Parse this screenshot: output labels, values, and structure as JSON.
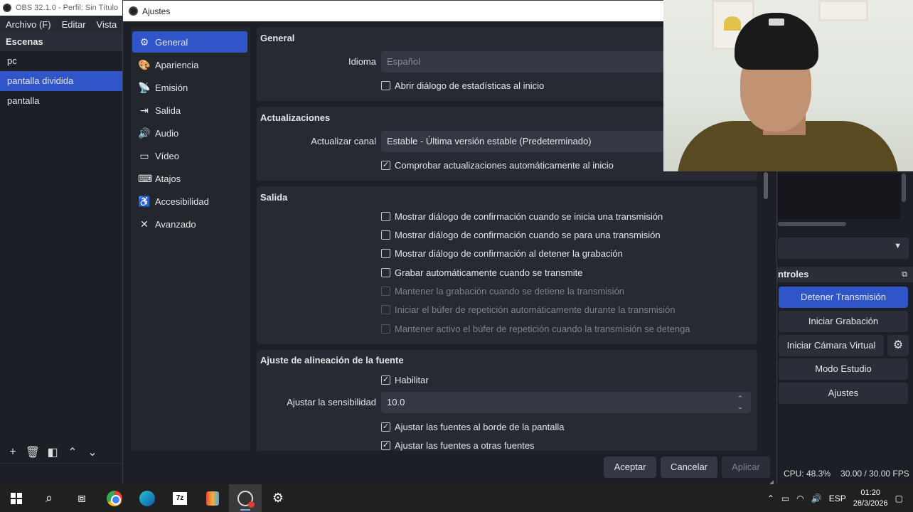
{
  "obs": {
    "title": "OBS 32.1.0 - Perfil: Sin Título",
    "menu": [
      "Archivo (F)",
      "Editar",
      "Vista"
    ],
    "scenes_header": "Escenas",
    "scenes": [
      "pc",
      "pantalla dividida",
      "pantalla"
    ],
    "controls_header": "ntroles",
    "controls": {
      "stop_stream": "Detener Transmisión",
      "start_record": "Iniciar Grabación",
      "virtual_cam": "Iniciar Cámara Virtual",
      "studio_mode": "Modo Estudio",
      "settings": "Ajustes"
    },
    "status": {
      "cpu": "CPU: 48.3%",
      "fps": "30.00 / 30.00 FPS"
    }
  },
  "dialog": {
    "title": "Ajustes",
    "nav": [
      {
        "label": "General",
        "icon": "gear-icon",
        "glyph": "⚙"
      },
      {
        "label": "Apariencia",
        "icon": "palette-icon",
        "glyph": "🎨"
      },
      {
        "label": "Emisión",
        "icon": "broadcast-icon",
        "glyph": "📡"
      },
      {
        "label": "Salida",
        "icon": "output-icon",
        "glyph": "⇥"
      },
      {
        "label": "Audio",
        "icon": "speaker-icon",
        "glyph": "🔊"
      },
      {
        "label": "Vídeo",
        "icon": "monitor-icon",
        "glyph": "▭"
      },
      {
        "label": "Atajos",
        "icon": "keyboard-icon",
        "glyph": "⌨"
      },
      {
        "label": "Accesibilidad",
        "icon": "accessibility-icon",
        "glyph": "♿"
      },
      {
        "label": "Avanzado",
        "icon": "tools-icon",
        "glyph": "✕"
      }
    ],
    "general": {
      "title": "General",
      "language_label": "Idioma",
      "language_value": "Español",
      "stats_dialog": "Abrir diálogo de estadísticas al inicio"
    },
    "updates": {
      "title": "Actualizaciones",
      "channel_label": "Actualizar canal",
      "channel_value": "Estable - Última versión estable (Predeterminado)",
      "auto_check": "Comprobar actualizaciones automáticamente al inicio"
    },
    "output": {
      "title": "Salida",
      "options": [
        {
          "label": "Mostrar diálogo de confirmación cuando se inicia una transmisión",
          "checked": false,
          "enabled": true
        },
        {
          "label": "Mostrar diálogo de confirmación cuando se para una transmisión",
          "checked": false,
          "enabled": true
        },
        {
          "label": "Mostrar diálogo de confirmación al detener la grabación",
          "checked": false,
          "enabled": true
        },
        {
          "label": "Grabar automáticamente cuando se transmite",
          "checked": false,
          "enabled": true
        },
        {
          "label": "Mantener la grabación cuando se detiene la transmisión",
          "checked": false,
          "enabled": false
        },
        {
          "label": "Iniciar el búfer de repetición automáticamente durante la transmisión",
          "checked": false,
          "enabled": false
        },
        {
          "label": "Mantener activo el búfer de repetición cuando la transmisión se detenga",
          "checked": false,
          "enabled": false
        }
      ]
    },
    "snapping": {
      "title": "Ajuste de alineación de la fuente",
      "enable": "Habilitar",
      "sensitivity_label": "Ajustar la sensibilidad",
      "sensitivity_value": "10.0",
      "screen_edge": "Ajustar las fuentes al borde de la pantalla",
      "other_sources": "Ajustar las fuentes a otras fuentes"
    },
    "buttons": {
      "accept": "Aceptar",
      "cancel": "Cancelar",
      "apply": "Aplicar"
    }
  },
  "taskbar": {
    "language": "ESP",
    "time": "01:20",
    "date": "28/3/2026"
  }
}
